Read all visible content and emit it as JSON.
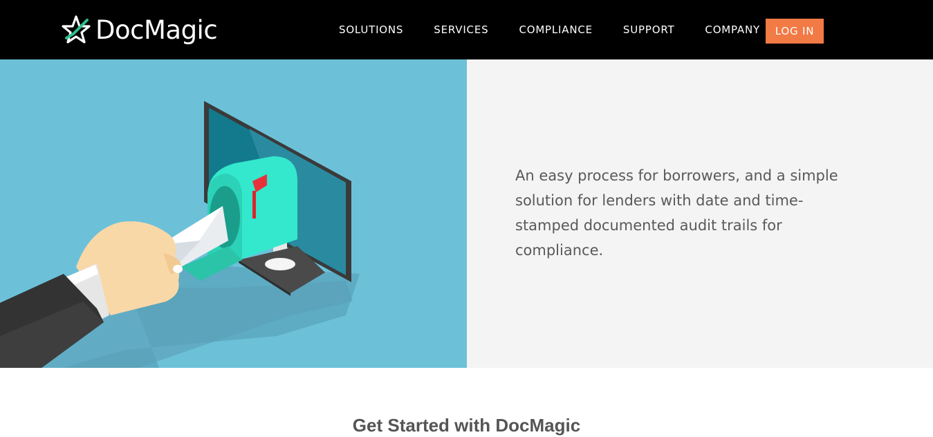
{
  "header": {
    "logo_text": "DocMagic",
    "logo_icon": "star-check-icon",
    "nav": [
      "SOLUTIONS",
      "SERVICES",
      "COMPLIANCE",
      "SUPPORT",
      "COMPANY"
    ],
    "login_label": "LOG IN"
  },
  "hero": {
    "description": "An easy process for borrowers, and a simple solution for lenders with date and time-stamped documented audit trails for compliance.",
    "illustration": "hand-mailing-letter-into-monitor-mailbox"
  },
  "section": {
    "heading": "Get Started with DocMagic"
  },
  "colors": {
    "header_bg": "#000000",
    "accent": "#f27a45",
    "hero_left_bg": "#6cc1d9",
    "hero_right_bg": "#f4f4f4",
    "mailbox": "#33e8cc"
  }
}
